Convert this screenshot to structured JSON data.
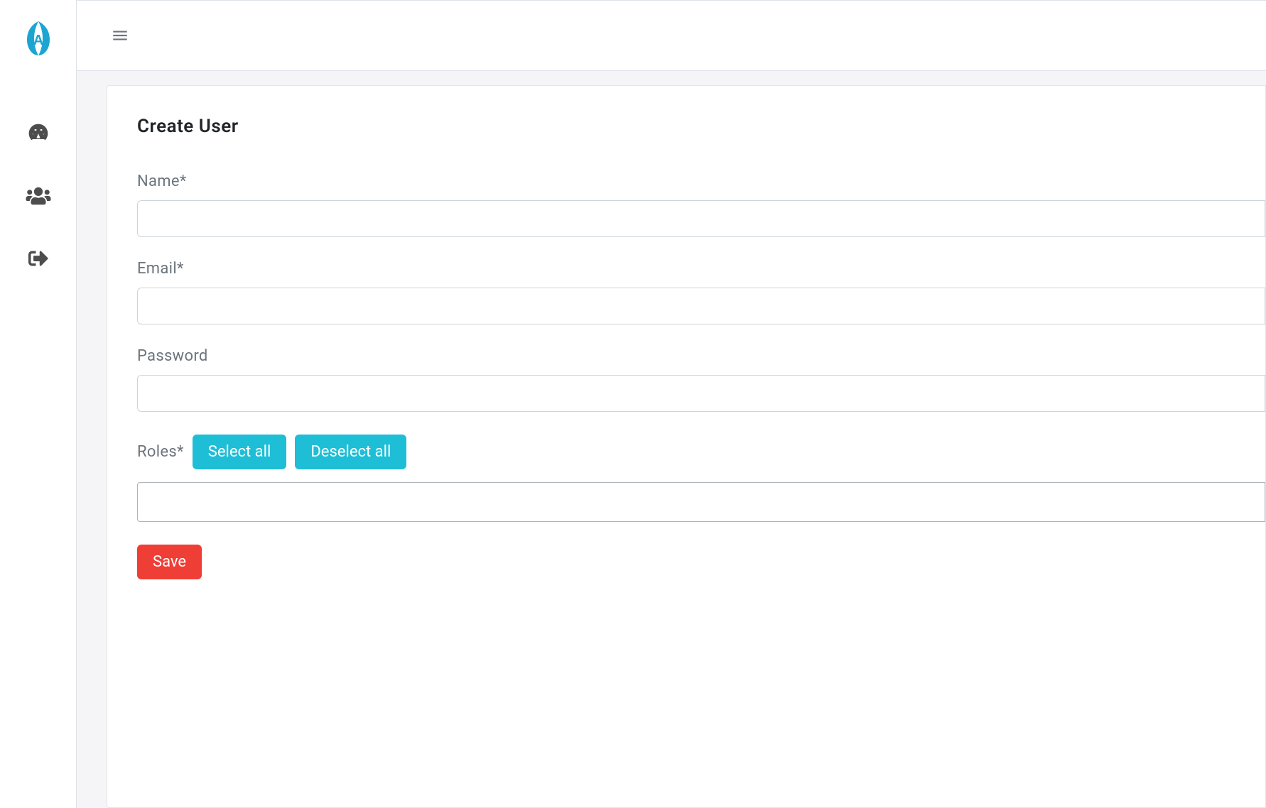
{
  "page": {
    "title": "Create User"
  },
  "form": {
    "name": {
      "label": "Name*",
      "value": ""
    },
    "email": {
      "label": "Email*",
      "value": ""
    },
    "password": {
      "label": "Password",
      "value": ""
    },
    "roles": {
      "label": "Roles*",
      "select_all": "Select all",
      "deselect_all": "Deselect all",
      "value": ""
    },
    "save": "Save"
  }
}
